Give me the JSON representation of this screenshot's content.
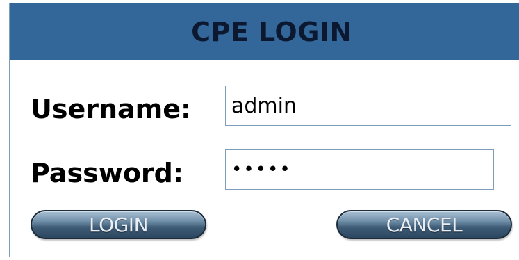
{
  "header": {
    "title": "CPE LOGIN",
    "background_color": "#336699"
  },
  "form": {
    "username_label": "Username:",
    "username_value": "admin",
    "password_label": "Password:",
    "password_value": "•••••",
    "login_label": "LOGIN",
    "cancel_label": "CANCEL"
  }
}
